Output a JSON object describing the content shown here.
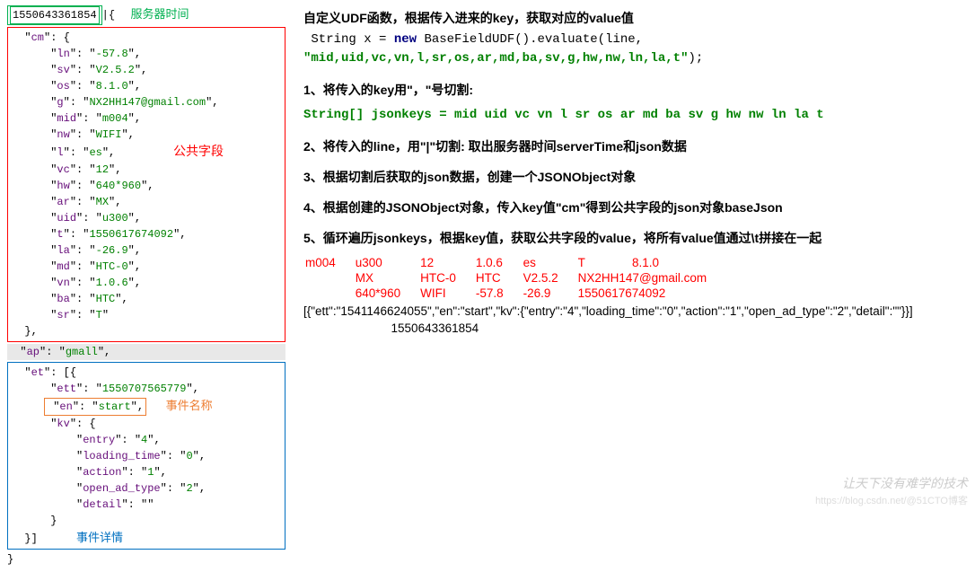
{
  "left": {
    "timestamp": "1550643361854",
    "server_time_label": "服务器时间",
    "public_fields_label": "公共字段",
    "event_name_label": "事件名称",
    "event_detail_label": "事件详情",
    "cm": {
      "ln": "-57.8",
      "sv": "V2.5.2",
      "os": "8.1.0",
      "g": "NX2HH147@gmail.com",
      "mid": "m004",
      "nw": "WIFI",
      "l": "es",
      "vc": "12",
      "hw": "640*960",
      "ar": "MX",
      "uid": "u300",
      "t": "1550617674092",
      "la": "-26.9",
      "md": "HTC-0",
      "vn": "1.0.6",
      "ba": "HTC",
      "sr": "T"
    },
    "ap": "gmall",
    "et": {
      "ett": "1550707565779",
      "en": "start",
      "kv": {
        "entry": "4",
        "loading_time": "0",
        "action": "1",
        "open_ad_type": "2",
        "detail": ""
      }
    }
  },
  "right": {
    "title": "自定义UDF函数，根据传入进来的key，获取对应的value值",
    "code1_a": "String x = ",
    "code1_new": "new",
    "code1_b": " BaseFieldUDF().evaluate(line,",
    "code1_c": "\"mid,uid,vc,vn,l,sr,os,ar,md,ba,sv,g,hw,nw,ln,la,t\"",
    "code1_d": ");",
    "step1": "1、将传入的key用\"，\"号切割:",
    "step1_code": "String[] jsonkeys = mid uid vc vn l sr os ar md ba sv g hw nw ln la t",
    "step2": "2、将传入的line，用\"|\"切割: 取出服务器时间serverTime和json数据",
    "step3": "3、根据切割后获取的json数据，创建一个JSONObject对象",
    "step4": "4、根据创建的JSONObject对象，传入key值\"cm\"得到公共字段的json对象baseJson",
    "step5": "5、循环遍历jsonkeys，根据key值，获取公共字段的value，将所有value值通过\\t拼接在一起",
    "result_rows": [
      [
        "m004",
        "u300",
        "12",
        "1.0.6",
        "es",
        "T",
        "8.1.0"
      ],
      [
        "MX",
        "HTC-0",
        "HTC",
        "V2.5.2",
        "NX2HH147@gmail.com"
      ],
      [
        "640*960",
        "WIFI",
        "-57.8",
        "-26.9",
        "1550617674092"
      ]
    ],
    "result_json_a": "[{\"ett\":\"1541146624055\",\"en\":\"start\",\"kv\":{\"entry\":\"4\",\"loading_time\":\"0\",\"action\":\"1\",\"open_ad_type\":\"2\",\"detail\":\"\"}}]",
    "result_json_b": "1550643361854"
  },
  "watermark": {
    "main": "让天下没有难学的技术",
    "sub": "https://blog.csdn.net/@51CTO博客"
  }
}
